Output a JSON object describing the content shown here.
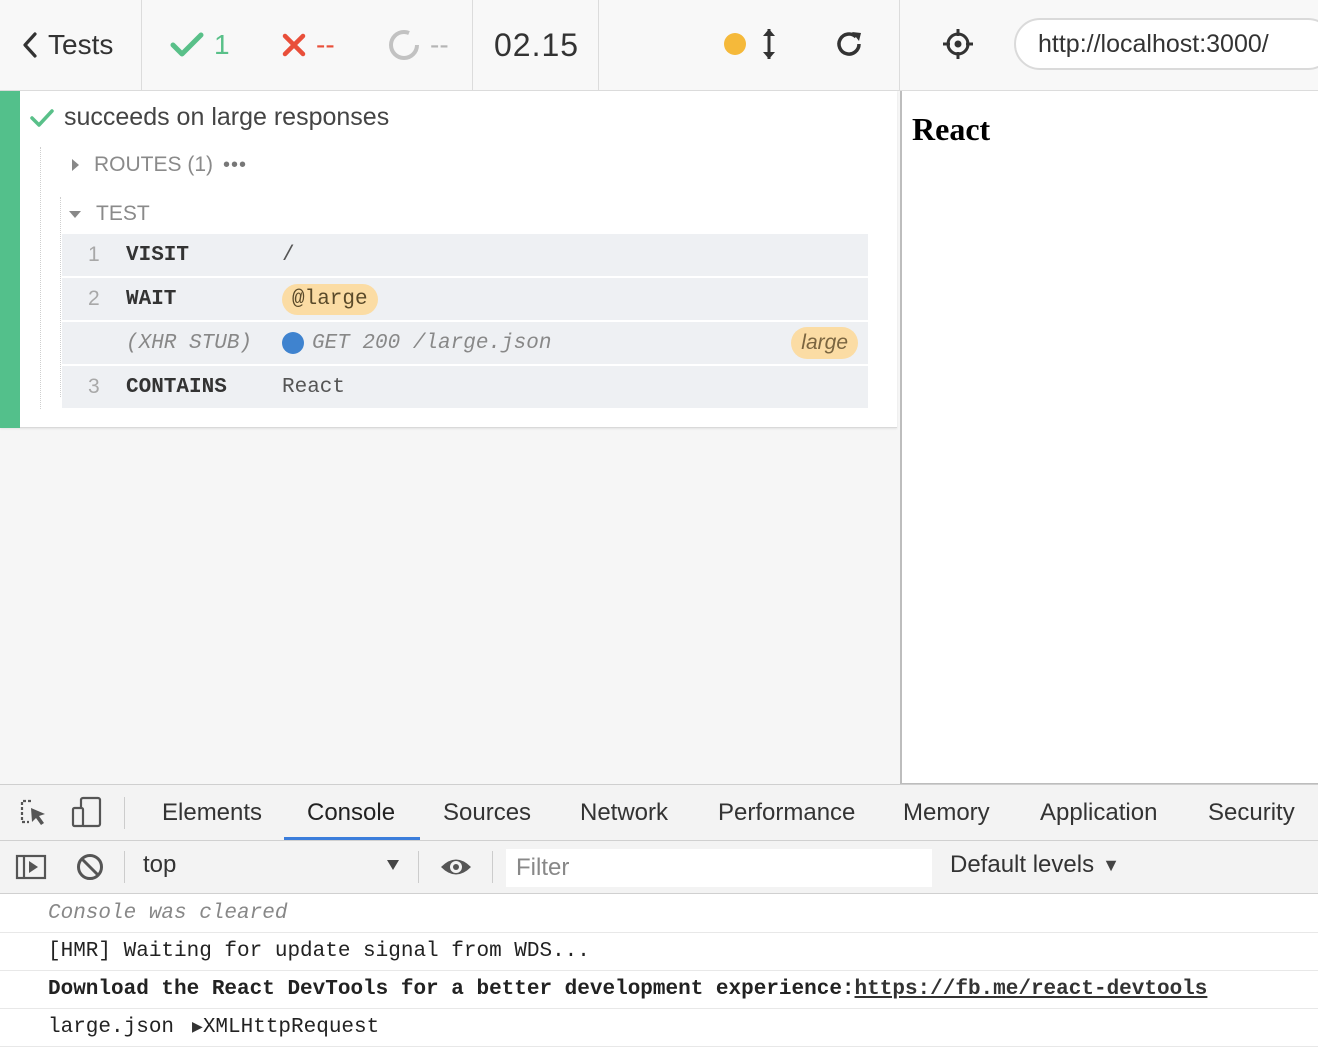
{
  "topbar": {
    "tests_label": "Tests",
    "passed": "1",
    "failed": "--",
    "pending": "--",
    "duration": "02.15",
    "url": "http://localhost:3000/",
    "status_dot_color": "#f5b93a"
  },
  "test": {
    "title": "succeeds on large responses",
    "routes_label": "ROUTES (1)",
    "routes_more": "•••",
    "test_label": "TEST",
    "commands": [
      {
        "num": "1",
        "name": "VISIT",
        "message": "/"
      },
      {
        "num": "2",
        "name": "WAIT",
        "message": "@large"
      },
      {
        "num": "",
        "name": "(XHR STUB)",
        "message": "GET 200 /large.json",
        "alias": "large"
      },
      {
        "num": "3",
        "name": "CONTAINS",
        "message": "React"
      }
    ]
  },
  "app": {
    "heading": "React"
  },
  "devtools": {
    "tabs": [
      "Elements",
      "Console",
      "Sources",
      "Network",
      "Performance",
      "Memory",
      "Application",
      "Security"
    ],
    "active_tab": "Console",
    "context": "top",
    "filter_placeholder": "Filter",
    "levels": "Default levels",
    "logs": {
      "cleared": "Console was cleared",
      "hmr": "[HMR] Waiting for update signal from WDS...",
      "devtools_msg": "Download the React DevTools for a better development experience: ",
      "devtools_link": "https://fb.me/react-devtools",
      "xhr_source": "large.json",
      "xhr_object": "XMLHttpRequest"
    }
  },
  "colors": {
    "pass": "#59c089",
    "fail": "#e94f3a",
    "accent_blue": "#3b7ddb",
    "alias_pill": "#fbdca4"
  }
}
